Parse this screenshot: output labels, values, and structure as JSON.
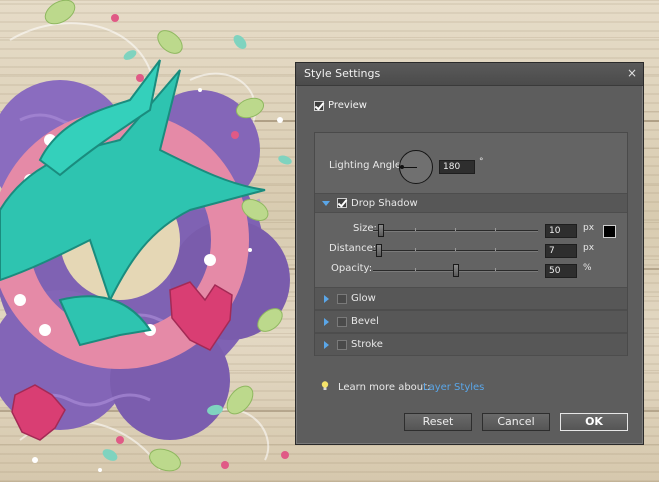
{
  "dialog": {
    "title": "Style Settings",
    "close_glyph": "×",
    "preview": {
      "label": "Preview",
      "checked": true
    },
    "lighting_angle": {
      "label": "Lighting Angle:",
      "value": "180",
      "unit": "°"
    },
    "drop_shadow": {
      "label": "Drop Shadow",
      "checked": true,
      "expanded": true,
      "size": {
        "label": "Size:",
        "value": "10",
        "unit": "px",
        "fraction": 0.03
      },
      "distance": {
        "label": "Distance:",
        "value": "7",
        "unit": "px",
        "fraction": 0.02
      },
      "opacity": {
        "label": "Opacity:",
        "value": "50",
        "unit": "%",
        "fraction": 0.5
      },
      "color": "#000000"
    },
    "sections": [
      {
        "label": "Glow",
        "checked": false,
        "expanded": false
      },
      {
        "label": "Bevel",
        "checked": false,
        "expanded": false
      },
      {
        "label": "Stroke",
        "checked": false,
        "expanded": false
      }
    ],
    "learn_more": {
      "label": "Learn more about:",
      "link": "Layer Styles",
      "icon": "lightbulb-icon"
    },
    "buttons": {
      "reset": "Reset",
      "cancel": "Cancel",
      "ok": "OK"
    }
  },
  "colors": {
    "dialog_bg": "#5d5d5d",
    "accent_link": "#5aa6e8",
    "artwork_teal": "#2ec4b0",
    "artwork_purple": "#7d5fb0",
    "artwork_pink": "#e07a9a"
  }
}
